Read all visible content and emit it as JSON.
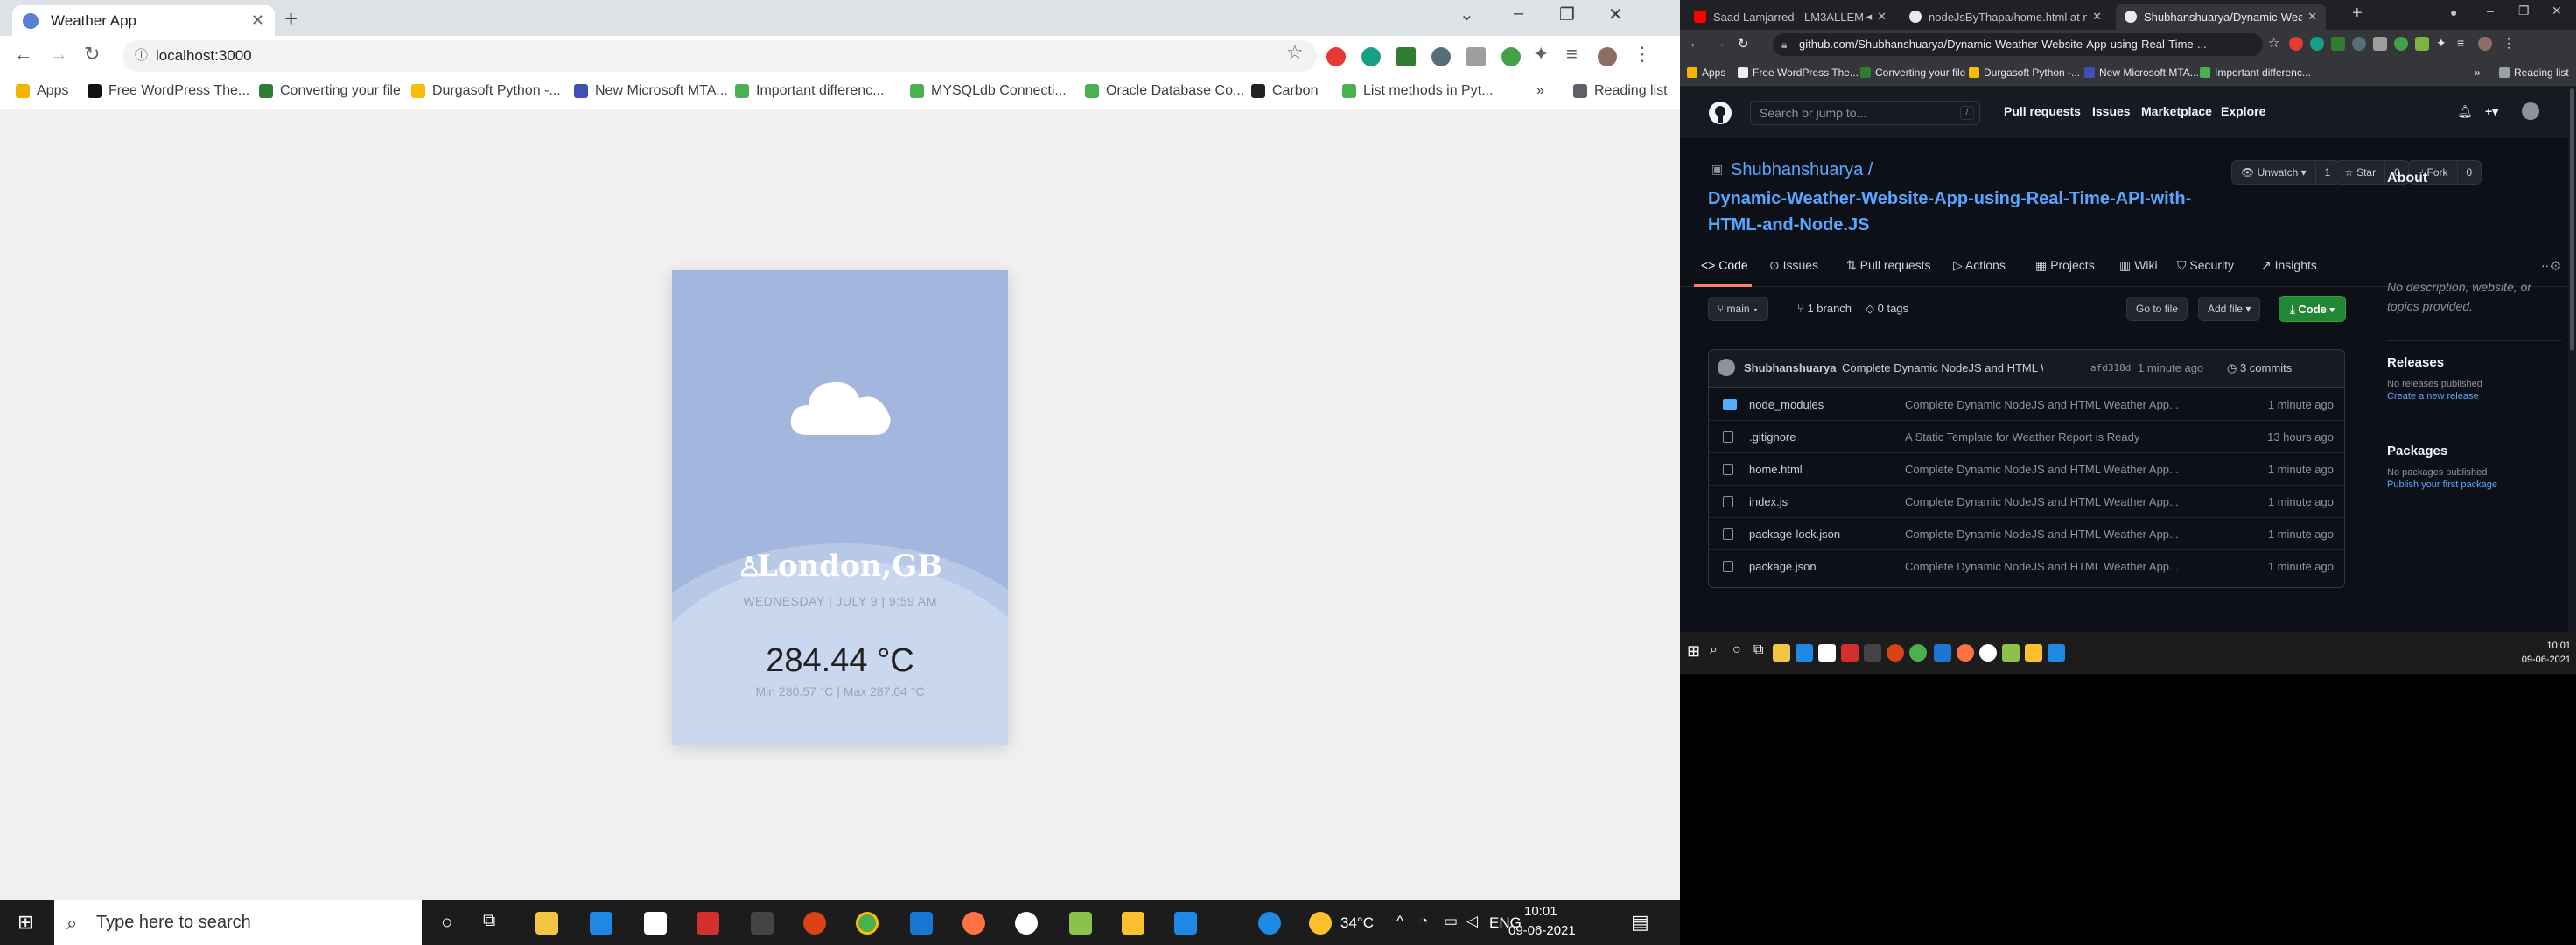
{
  "left": {
    "tab_title": "Weather App",
    "url": "localhost:3000",
    "bookmarks": [
      "Apps",
      "Free WordPress The...",
      "Converting your file",
      "Durgasoft Python -...",
      "New Microsoft MTA...",
      "Important differenc...",
      "MYSQLdb Connecti...",
      "Oracle Database Co...",
      "Carbon",
      "List methods in Pyt..."
    ],
    "bookmarks_overflow": "»",
    "reading_list": "Reading list",
    "weather": {
      "city": "London,GB",
      "date": "WEDNESDAY | JULY 9 | 9:59 AM",
      "temp": "284.44 °C",
      "minmax": "Min 280.57 °C | Max 287.04 °C"
    },
    "taskbar": {
      "search_placeholder": "Type here to search",
      "weather_temp": "34°C",
      "lang": "ENG",
      "time": "10:01",
      "date": "09-06-2021"
    }
  },
  "right": {
    "tabs": [
      "Saad Lamjarred - LM3ALLEM",
      "nodeJsByThapa/home.html at m",
      "Shubhanshuarya/Dynamic-Wea"
    ],
    "url": "github.com/Shubhanshuarya/Dynamic-Weather-Website-App-using-Real-Time-...",
    "bookmarks": [
      "Apps",
      "Free WordPress The...",
      "Converting your file",
      "Durgasoft Python -...",
      "New Microsoft MTA...",
      "Important differenc..."
    ],
    "bookmarks_overflow": "»",
    "reading_list": "Reading list",
    "github": {
      "search": "Search or jump to...",
      "search_key": "/",
      "nav": [
        "Pull requests",
        "Issues",
        "Marketplace",
        "Explore"
      ],
      "owner": "Shubhanshuarya /",
      "repo": "Dynamic-Weather-Website-App-using-Real-Time-API-with-HTML-and-Node.JS",
      "watch": {
        "label": "Unwatch ▾",
        "count": "1"
      },
      "star": {
        "label": "Star",
        "count": "0"
      },
      "fork": {
        "label": "Fork",
        "count": "0"
      },
      "tabs": [
        "Code",
        "Issues",
        "Pull requests",
        "Actions",
        "Projects",
        "Wiki",
        "Security",
        "Insights"
      ],
      "more": "···",
      "branch_btn": "main ▾",
      "branches": "1 branch",
      "tags": "0 tags",
      "go_to_file": "Go to file",
      "add_file": "Add file ▾",
      "code_btn": "Code ▾",
      "commit": {
        "author": "Shubhanshuarya",
        "message": "Complete Dynamic NodeJS and HTML W...",
        "hash": "afd318d",
        "time": "1 minute ago",
        "commits": "3 commits"
      },
      "files": [
        {
          "name": "node_modules",
          "type": "folder",
          "message": "Complete Dynamic NodeJS and HTML Weather App...",
          "time": "1 minute ago"
        },
        {
          "name": ".gitignore",
          "type": "file",
          "message": "A Static Template for Weather Report is Ready",
          "time": "13 hours ago"
        },
        {
          "name": "home.html",
          "type": "file",
          "message": "Complete Dynamic NodeJS and HTML Weather App...",
          "time": "1 minute ago"
        },
        {
          "name": "index.js",
          "type": "file",
          "message": "Complete Dynamic NodeJS and HTML Weather App...",
          "time": "1 minute ago"
        },
        {
          "name": "package-lock.json",
          "type": "file",
          "message": "Complete Dynamic NodeJS and HTML Weather App...",
          "time": "1 minute ago"
        },
        {
          "name": "package.json",
          "type": "file",
          "message": "Complete Dynamic NodeJS and HTML Weather App...",
          "time": "1 minute ago"
        }
      ],
      "about": {
        "title": "About",
        "desc": "No description, website, or topics provided."
      },
      "releases": {
        "title": "Releases",
        "none": "No releases published",
        "link": "Create a new release"
      },
      "packages": {
        "title": "Packages",
        "none": "No packages published",
        "link": "Publish your first package"
      }
    },
    "taskbar": {
      "time": "10:01",
      "date": "09-06-2021"
    }
  }
}
